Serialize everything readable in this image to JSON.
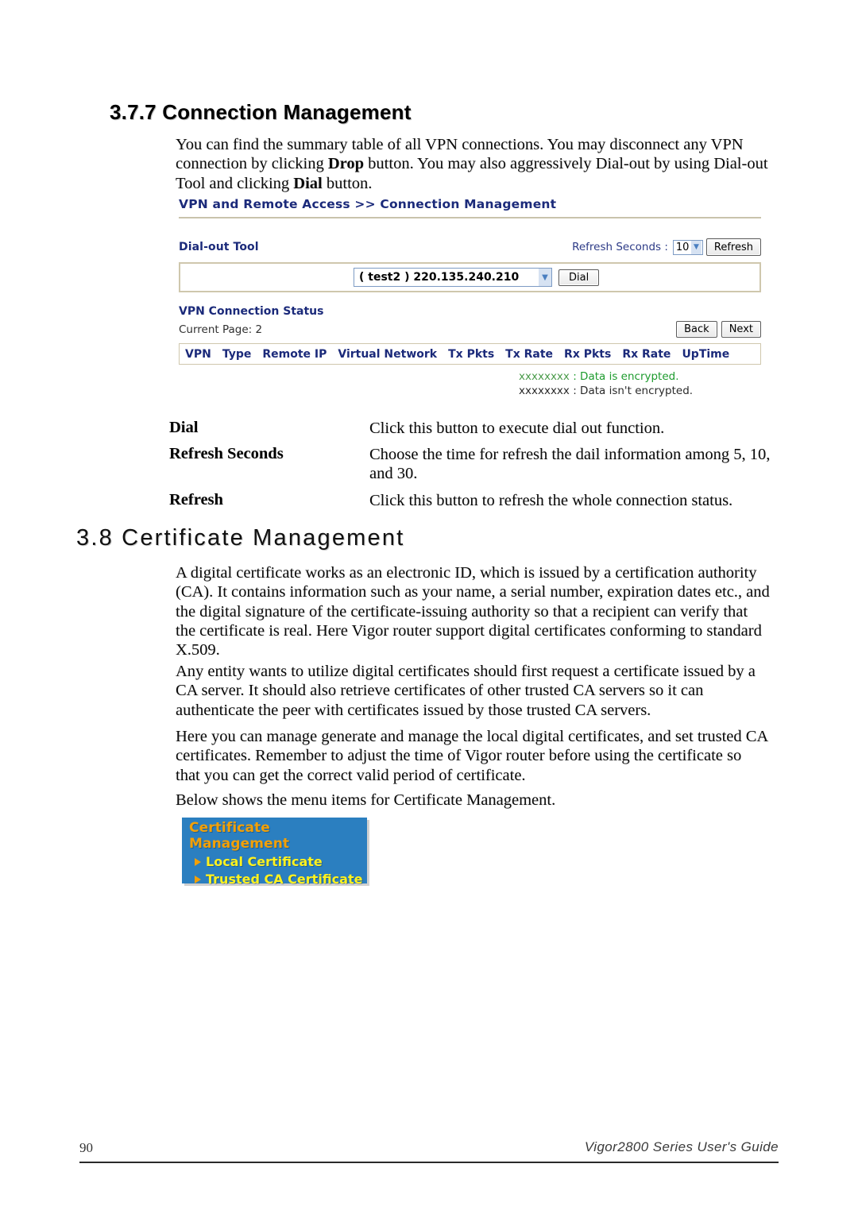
{
  "document": {
    "section_heading": "3.7.7 Connection Management",
    "intro_paragraph": {
      "part1": "You can find the summary table of all VPN connections. You may disconnect any VPN connection by clicking ",
      "bold1": "Drop",
      "part2": " button. You may also aggressively Dial-out by using Dial-out Tool and clicking ",
      "bold2": "Dial",
      "part3": " button."
    },
    "section2_heading": "3.8 Certificate Management",
    "paragraphs": [
      "A digital certificate works as an electronic ID, which is issued by a certification authority (CA). It contains information such as your name, a serial number, expiration dates etc., and the digital signature of the certificate-issuing authority so that a recipient can verify that the certificate is real. Here Vigor router support digital certificates conforming to standard X.509.",
      "Any entity wants to utilize digital certificates should first request a certificate issued by a CA server. It should also retrieve certificates of other trusted CA servers so it can authenticate the peer with certificates issued by those trusted CA servers.",
      "Here you can manage generate and manage the local digital certificates, and set trusted CA certificates. Remember to adjust the time of Vigor router before using the certificate so that you can get the correct valid period of certificate.",
      "Below shows the menu items for Certificate Management."
    ]
  },
  "router_ui": {
    "breadcrumb": "VPN and Remote Access >> Connection Management",
    "dialout": {
      "label": "Dial-out Tool",
      "refresh_seconds_label": "Refresh Seconds :",
      "refresh_seconds_value": "10",
      "refresh_seconds_options": [
        "5",
        "10",
        "30"
      ],
      "refresh_button": "Refresh",
      "profile_value": "( test2 ) 220.135.240.210",
      "dial_button": "Dial"
    },
    "status": {
      "label": "VPN Connection Status",
      "current_page_label": "Current Page:",
      "current_page_value": "2",
      "back_button": "Back",
      "next_button": "Next",
      "columns": [
        "VPN",
        "Type",
        "Remote IP",
        "Virtual Network",
        "Tx Pkts",
        "Tx Rate",
        "Rx Pkts",
        "Rx Rate",
        "UpTime"
      ],
      "legend": [
        {
          "mark": "xxxxxxxx",
          "text": ": Data is encrypted.",
          "color": "#1e9b2e"
        },
        {
          "mark": "xxxxxxxx",
          "text": ": Data isn't encrypted.",
          "color": "#2a2a2a"
        }
      ]
    }
  },
  "definitions": [
    {
      "term": "Dial",
      "desc": "Click this button to execute dial out function."
    },
    {
      "term": "Refresh Seconds",
      "desc": "Choose the time for refresh the dail information among 5, 10, and 30."
    },
    {
      "term": "Refresh",
      "desc": "Click this button to refresh the whole connection status."
    }
  ],
  "certificate_menu": {
    "title": "Certificate Management",
    "items": [
      "Local Certificate",
      "Trusted CA Certificate"
    ],
    "background_color": "#2b7fc0",
    "title_color": "#f2a007",
    "item_color": "#fff21f"
  },
  "footer": {
    "page_number": "90",
    "guide_title": "Vigor2800 Series User's Guide"
  }
}
